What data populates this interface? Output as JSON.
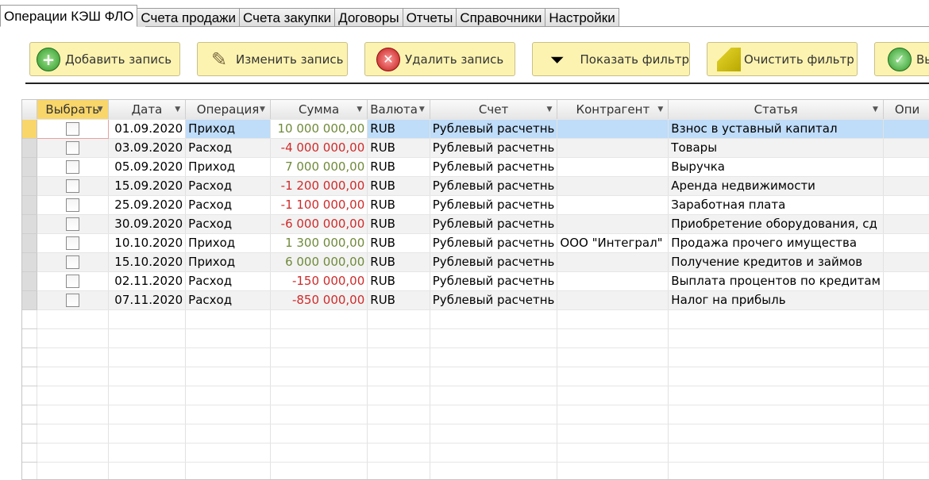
{
  "tabs": [
    "Операции КЭШ ФЛО",
    "Счета продажи",
    "Счета закупки",
    "Договоры",
    "Отчеты",
    "Справочники",
    "Настройки"
  ],
  "toolbar": {
    "add": "Добавить запись",
    "edit": "Изменить запись",
    "delete": "Удалить запись",
    "show_filter": "Показать фильтр",
    "clear_filter": "Очистить фильтр",
    "last": "Вы"
  },
  "columns": [
    "Выбрать",
    "Дата",
    "Операция",
    "Сумма",
    "Валюта",
    "Счет",
    "Контрагент",
    "Статья",
    "Опи"
  ],
  "rows": [
    {
      "date": "01.09.2020",
      "op": "Приход",
      "sum": "10 000 000,00",
      "cur": "RUB",
      "acc": "Рублевый расчетнь",
      "cp": "",
      "item": "Взнос в уставный капитал"
    },
    {
      "date": "03.09.2020",
      "op": "Расход",
      "sum": "-4 000 000,00",
      "cur": "RUB",
      "acc": "Рублевый расчетнь",
      "cp": "",
      "item": "Товары"
    },
    {
      "date": "05.09.2020",
      "op": "Приход",
      "sum": "7 000 000,00",
      "cur": "RUB",
      "acc": "Рублевый расчетнь",
      "cp": "",
      "item": "Выручка"
    },
    {
      "date": "15.09.2020",
      "op": "Расход",
      "sum": "-1 200 000,00",
      "cur": "RUB",
      "acc": "Рублевый расчетнь",
      "cp": "",
      "item": "Аренда недвижимости"
    },
    {
      "date": "25.09.2020",
      "op": "Расход",
      "sum": "-1 100 000,00",
      "cur": "RUB",
      "acc": "Рублевый расчетнь",
      "cp": "",
      "item": "Заработная плата"
    },
    {
      "date": "30.09.2020",
      "op": "Расход",
      "sum": "-6 000 000,00",
      "cur": "RUB",
      "acc": "Рублевый расчетнь",
      "cp": "",
      "item": "Приобретение оборудования, сд"
    },
    {
      "date": "10.10.2020",
      "op": "Приход",
      "sum": "1 300 000,00",
      "cur": "RUB",
      "acc": "Рублевый расчетнь",
      "cp": "ООО \"Интеграл\"",
      "item": "Продажа прочего имущества"
    },
    {
      "date": "15.10.2020",
      "op": "Приход",
      "sum": "6 000 000,00",
      "cur": "RUB",
      "acc": "Рублевый расчетнь",
      "cp": "",
      "item": "Получение кредитов и займов"
    },
    {
      "date": "02.11.2020",
      "op": "Расход",
      "sum": "-150 000,00",
      "cur": "RUB",
      "acc": "Рублевый расчетнь",
      "cp": "",
      "item": "Выплата процентов по кредитам"
    },
    {
      "date": "07.11.2020",
      "op": "Расход",
      "sum": "-850 000,00",
      "cur": "RUB",
      "acc": "Рублевый расчетнь",
      "cp": "",
      "item": "Налог на прибыль"
    }
  ]
}
